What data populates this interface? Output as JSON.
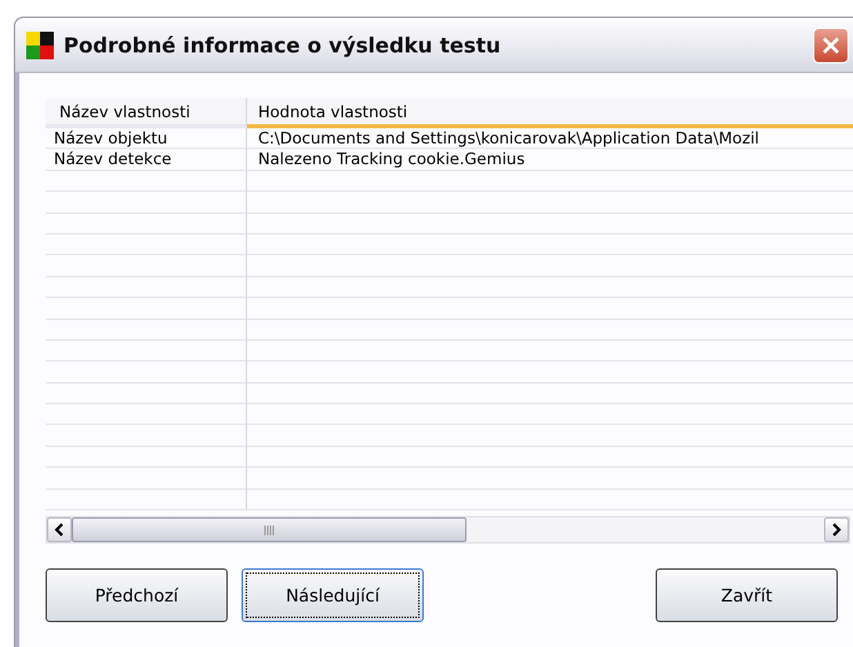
{
  "window": {
    "title": "Podrobné informace o výsledku testu"
  },
  "table": {
    "columns": [
      "Název vlastnosti",
      "Hodnota vlastnosti"
    ],
    "rows": [
      [
        "Název objektu",
        "C:\\Documents and Settings\\konicarovak\\Application Data\\Mozil"
      ],
      [
        "Název detekce",
        "Nalezeno Tracking cookie.Gemius"
      ]
    ]
  },
  "buttons": [
    {
      "label": "Předchozí",
      "focused": false
    },
    {
      "label": "Následující",
      "focused": true
    },
    {
      "label": "Zavřít",
      "focused": false
    }
  ]
}
